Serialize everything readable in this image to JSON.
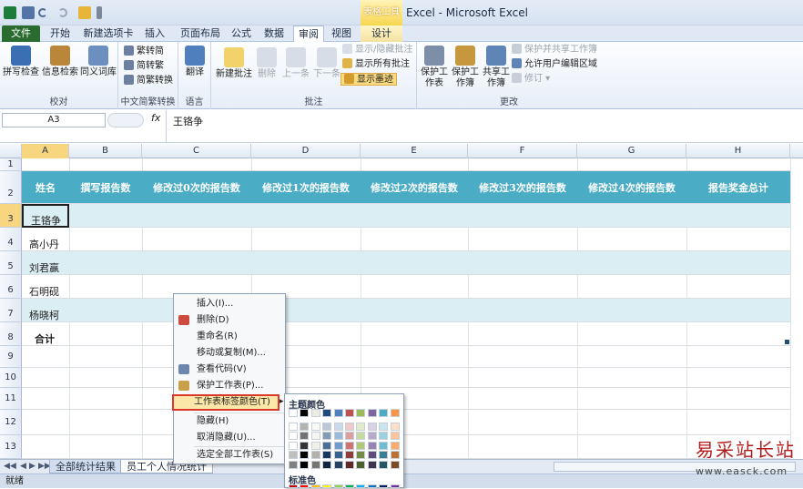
{
  "window": {
    "title": "Excel - Microsoft Excel",
    "context_tab_header": "表格工具"
  },
  "tabs": [
    {
      "label": "文件"
    },
    {
      "label": "开始"
    },
    {
      "label": "新建选项卡"
    },
    {
      "label": "插入"
    },
    {
      "label": "页面布局"
    },
    {
      "label": "公式"
    },
    {
      "label": "数据"
    },
    {
      "label": "审阅"
    },
    {
      "label": "视图"
    },
    {
      "label": "设计"
    }
  ],
  "ribbon": {
    "proofing": {
      "label": "校对",
      "spell": "拼写检查",
      "research": "信息检索",
      "thesaurus": "同义词库"
    },
    "chinese": {
      "label": "中文简繁转换",
      "to_trad": "繁转简",
      "to_simp": "简转繁",
      "convert": "简繁转换"
    },
    "language": {
      "label": "语言",
      "translate": "翻译"
    },
    "comments": {
      "label": "批注",
      "new": "新建批注",
      "delete": "删除",
      "prev": "上一条",
      "next": "下一条",
      "show_hide": "显示/隐藏批注",
      "show_all": "显示所有批注",
      "show_ink": "显示墨迹"
    },
    "changes": {
      "label": "更改",
      "protect_sheet": "保护工作表",
      "protect_book": "保护工作簿",
      "share_book": "共享工作簿",
      "protect_share": "保护并共享工作簿",
      "allow_edit": "允许用户编辑区域",
      "track": "修订"
    }
  },
  "formula_bar": {
    "name_box": "A3",
    "fx": "fx",
    "content": "王铬争"
  },
  "columns": [
    "A",
    "B",
    "C",
    "D",
    "E",
    "F",
    "G",
    "H"
  ],
  "rows": [
    "1",
    "2",
    "3",
    "4",
    "5",
    "6",
    "7",
    "8",
    "9",
    "10",
    "11",
    "12",
    "13"
  ],
  "table": {
    "headers": [
      "姓名",
      "撰写报告数",
      "修改过0次的报告数",
      "修改过1次的报告数",
      "修改过2次的报告数",
      "修改过3次的报告数",
      "修改过4次的报告数",
      "报告奖金总计"
    ],
    "names": [
      "王铬争",
      "高小丹",
      "刘君赢",
      "石明砚",
      "杨晓柯"
    ],
    "total_label": "合计"
  },
  "context_menu": [
    {
      "label": "插入(I)..."
    },
    {
      "label": "删除(D)"
    },
    {
      "label": "重命名(R)"
    },
    {
      "label": "移动或复制(M)..."
    },
    {
      "label": "查看代码(V)"
    },
    {
      "label": "保护工作表(P)..."
    },
    {
      "label": "工作表标签颜色(T)"
    },
    {
      "label": "隐藏(H)"
    },
    {
      "label": "取消隐藏(U)..."
    },
    {
      "label": "选定全部工作表(S)"
    }
  ],
  "palette": {
    "theme_title": "主题颜色",
    "standard_title": "标准色",
    "theme_colors": [
      "#ffffff",
      "#000000",
      "#eeece1",
      "#1f497d",
      "#4f81bd",
      "#c0504d",
      "#9bbb59",
      "#8064a2",
      "#4bacc6",
      "#f79646"
    ],
    "standard_colors": [
      "#c00000",
      "#ff0000",
      "#ffc000",
      "#ffff00",
      "#92d050",
      "#00b050",
      "#00b0f0",
      "#0070c0",
      "#002060",
      "#7030a0"
    ]
  },
  "sheet_tabs": [
    "全部统计结果",
    "员工个人情况统计"
  ],
  "status": "就绪",
  "watermark": {
    "title": "易采站长站",
    "url": "www.easck.com"
  }
}
